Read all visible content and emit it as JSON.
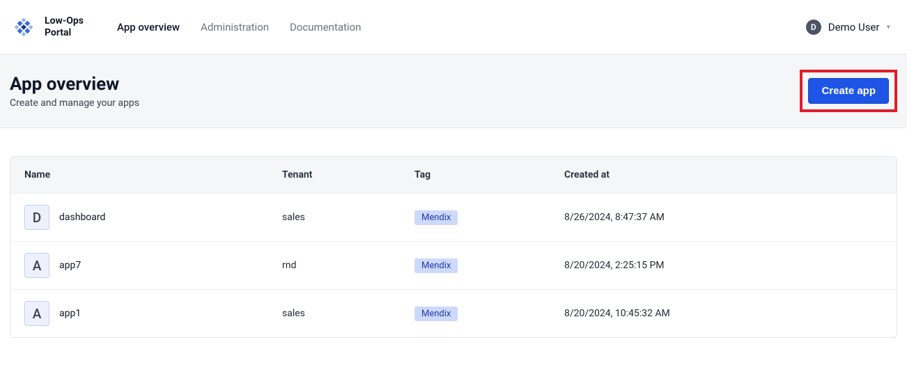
{
  "brand": {
    "line1": "Low-Ops",
    "line2": "Portal"
  },
  "nav": {
    "overview": "App overview",
    "admin": "Administration",
    "docs": "Documentation"
  },
  "user": {
    "initial": "D",
    "name": "Demo User"
  },
  "page": {
    "title": "App overview",
    "subtitle": "Create and manage your apps",
    "create_label": "Create app"
  },
  "columns": {
    "name": "Name",
    "tenant": "Tenant",
    "tag": "Tag",
    "created": "Created at"
  },
  "rows": [
    {
      "initial": "D",
      "name": "dashboard",
      "tenant": "sales",
      "tag": "Mendix",
      "created": "8/26/2024, 8:47:37 AM"
    },
    {
      "initial": "A",
      "name": "app7",
      "tenant": "rnd",
      "tag": "Mendix",
      "created": "8/20/2024, 2:25:15 PM"
    },
    {
      "initial": "A",
      "name": "app1",
      "tenant": "sales",
      "tag": "Mendix",
      "created": "8/20/2024, 10:45:32 AM"
    }
  ]
}
